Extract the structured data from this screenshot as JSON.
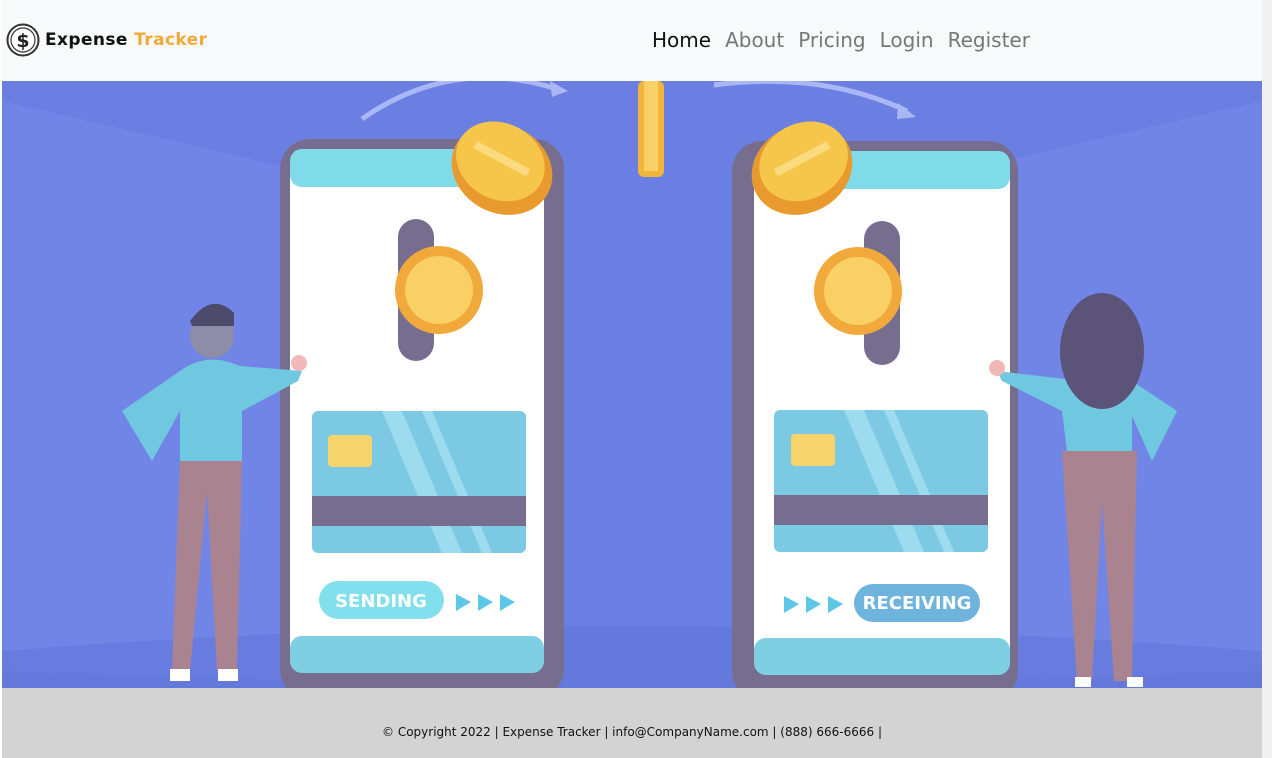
{
  "app": {
    "brand_name_part1": "Expense",
    "brand_name_part2": "Tracker",
    "logo_icon": "dollar-coin-icon",
    "brand_accent_color": "#f2a93b"
  },
  "nav": {
    "items": [
      {
        "label": "Home",
        "active": true
      },
      {
        "label": "About",
        "active": false
      },
      {
        "label": "Pricing",
        "active": false
      },
      {
        "label": "Login",
        "active": false
      },
      {
        "label": "Register",
        "active": false
      }
    ]
  },
  "hero": {
    "illustration": "money-transfer-illustration",
    "background_color": "#6b7fe3",
    "left_phone_label": "SENDING",
    "right_phone_label": "RECEIVING"
  },
  "footer": {
    "copyright_text": "© Copyright 2022 | Expense Tracker | info@CompanyName.com | (888) 666-6666 |",
    "background_color": "#d3d3d3"
  }
}
